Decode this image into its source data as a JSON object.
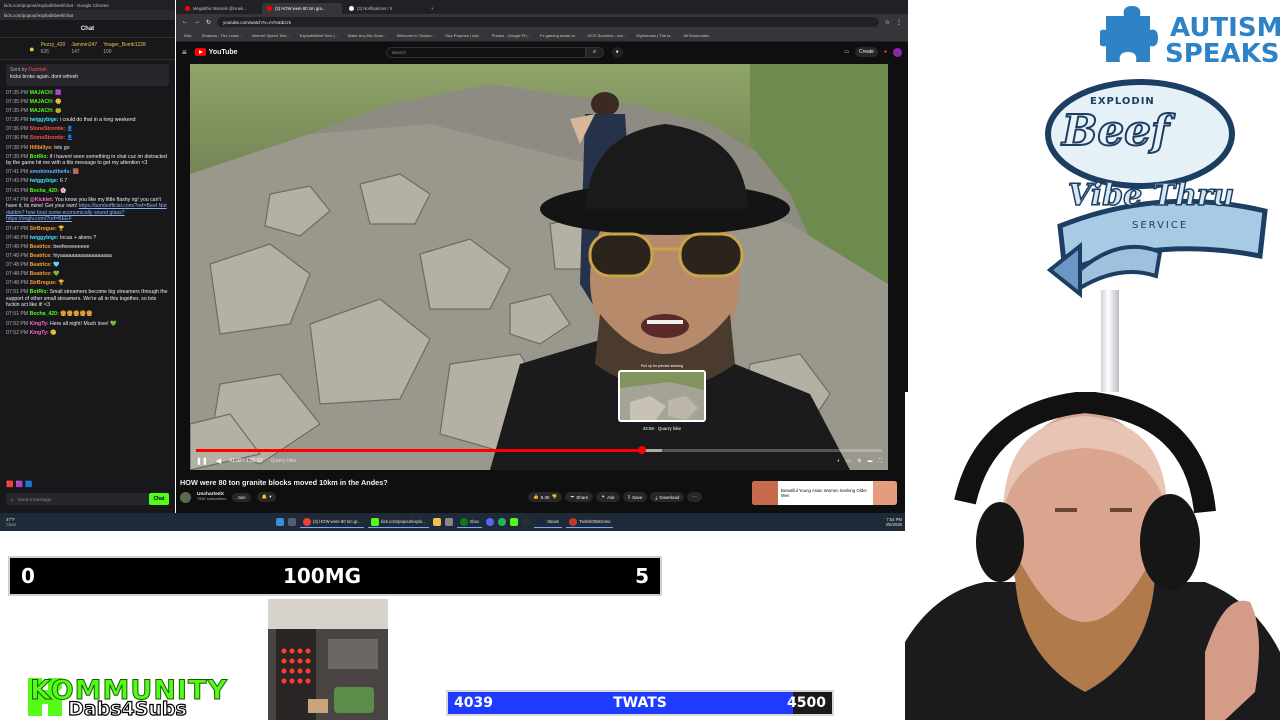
{
  "chat": {
    "window_title": "kick.com/popout/explodinbeef/chat - Google Chrome",
    "url": "kick.com/popout/explodinbeef/chat",
    "header": "Chat",
    "gifters": [
      {
        "name": "Pezzy_420",
        "count": "626"
      },
      {
        "name": "Jammin247",
        "count": "147"
      },
      {
        "name": "Yeager_Bomb1228",
        "count": "100"
      }
    ],
    "pinned_by": "Sent by",
    "pinned_user": "Dachiah",
    "pinned_text": "kicks broke again. dont refresh",
    "messages": [
      {
        "time": "07:35 PM",
        "user": "MAJACH:",
        "color": "u-green",
        "text": "🟪"
      },
      {
        "time": "07:35 PM",
        "user": "MAJACH:",
        "color": "u-green",
        "text": "🥲"
      },
      {
        "time": "07:35 PM",
        "user": "MAJACH:",
        "color": "u-green",
        "text": "🐸"
      },
      {
        "time": "07:36 PM",
        "user": "twiggybige:",
        "color": "u-cyan",
        "text": "i could do that in a long weekend"
      },
      {
        "time": "07:36 PM",
        "user": "StoneStrontie:",
        "color": "u-red",
        "text": "👤"
      },
      {
        "time": "07:36 PM",
        "user": "StoneStrontie:",
        "color": "u-red",
        "text": "👤"
      },
      {
        "time": "07:38 PM",
        "user": "Hillbillys:",
        "color": "u-orange",
        "text": "lets go"
      },
      {
        "time": "07:39 PM",
        "user": "BotRix:",
        "color": "u-green",
        "text": "if i havent seen something in chat cuz im distracted by the game hit me with a ttts message to get my attention <3"
      },
      {
        "time": "07:41 PM",
        "user": "smokinoutthe4s:",
        "color": "u-blue",
        "text": "🟫"
      },
      {
        "time": "07:43 PM",
        "user": "twiggybige:",
        "color": "u-cyan",
        "text": "6 7"
      },
      {
        "time": "07:43 PM",
        "user": "Bocha_420:",
        "color": "u-green",
        "text": "🌸"
      },
      {
        "time": "07:47 PM",
        "user": "@Kicklet:",
        "color": "u-pink",
        "text": "You know you like my little flashy rig! you can't have it, its mine! Get your own!",
        "link": "https://bombofficial.com/?ref=Beef Not dabbin? how bout some economically sound glass? https://ooglv.com/?ref=BEEF"
      },
      {
        "time": "07:47 PM",
        "user": "StrBrogue:",
        "color": "u-orange",
        "text": "🏆"
      },
      {
        "time": "07:48 PM",
        "user": "twiggybige:",
        "color": "u-cyan",
        "text": "Incas + aliens ?"
      },
      {
        "time": "07:48 PM",
        "user": "BeatrIce:",
        "color": "u-orange",
        "text": "beefeeeeeeeee"
      },
      {
        "time": "07:48 PM",
        "user": "BeatrIce:",
        "color": "u-orange",
        "text": "hiyaaaaaaaaaaaaaaaaaa"
      },
      {
        "time": "07:48 PM",
        "user": "BeatrIce:",
        "color": "u-orange",
        "text": "🩵"
      },
      {
        "time": "07:48 PM",
        "user": "BeatrIce:",
        "color": "u-orange",
        "text": "💚"
      },
      {
        "time": "07:48 PM",
        "user": "StrBrogue:",
        "color": "u-orange",
        "text": "🏆"
      },
      {
        "time": "07:51 PM",
        "user": "BotRix:",
        "color": "u-green",
        "text": "Small streamers become big streamers through the support of other small streamers. We're all in this together, so lets fuckin act like it! <3"
      },
      {
        "time": "07:51 PM",
        "user": "Bocha_420:",
        "color": "u-green",
        "text": "🍔🍔🍔🍔🍔"
      },
      {
        "time": "07:52 PM",
        "user": "KingTy:",
        "color": "u-pink",
        "text": "Here all night! Much love! 💚"
      },
      {
        "time": "07:52 PM",
        "user": "KingTy:",
        "color": "u-pink",
        "text": "🥲"
      }
    ],
    "input_placeholder": "Send a message",
    "send_label": "Chat"
  },
  "browser": {
    "tabs": [
      {
        "label": "Megalithic Marvels @Ixnek...",
        "color": "#ff0000",
        "active": false
      },
      {
        "label": "(3) HOW were 80 ton gra...",
        "color": "#ff0000",
        "active": true
      },
      {
        "label": "(3) Notifications / X",
        "color": "#ffffff",
        "active": false
      }
    ],
    "url": "youtube.com/watch?v=m7eatbzzk",
    "bookmarks": [
      "Kick",
      "Shakeus - The Leadi...",
      "Internet Speed Test...",
      "ExplodinBeef Scrs |...",
      "Make Any Mic Soun...",
      "Welcome to Okloho...",
      "Your Purpose | clot...",
      "Photos - Google Ph...",
      "Fe gaming music w...",
      "KICK Bounties - win...",
      "Mymonaris | The la...",
      "All Bookmarks"
    ]
  },
  "youtube": {
    "brand": "YouTube",
    "search_placeholder": "Search",
    "create_label": "Create",
    "video_title": "HOW were 80 ton granite blocks moved 10km in the Andes?",
    "channel": "UnchartedX",
    "subscribers": "783K subscribers",
    "join_label": "Join",
    "time_current": "41:32",
    "time_total": "1:26:33",
    "chapter": "Quarry hike",
    "progress_fraction": 0.65,
    "buffer_fraction": 0.68,
    "hover_time": "43:59",
    "hover_chapter": "Quarry hike",
    "hover_tip": "Pull up for precise seeking",
    "likes": "8.3K",
    "share_label": "Share",
    "ask_label": "Ask",
    "save_label": "Save",
    "download_label": "Download",
    "ad_text": "Beautiful Young Asian Women Seeking Older Men"
  },
  "taskbar": {
    "weather_temp": "47°F",
    "weather_desc": "Clear",
    "apps": [
      "(3) HOW were 80 ton gr...",
      "kick.com/popout/explo...",
      "Xbox",
      "Steam",
      "TwitchOBsDemo"
    ],
    "time": "7:54 PM",
    "date": "2/5/2026"
  },
  "overlays": {
    "score_top": {
      "left": "0",
      "center": "100MG",
      "right": "5"
    },
    "score_bottom": {
      "left": "4039",
      "center": "TWATS",
      "right": "4500",
      "fill_fraction": 0.8976
    },
    "kommunity_title": "KOMMUNITY",
    "kommunity_sub": "Dabs4Subs",
    "autism_line1": "AUTISM",
    "autism_line2": "SPEAKS",
    "beef_top": "EXPLODIN",
    "beef_main": "Beef",
    "beef_script": "Vibe Thru",
    "beef_service": "SERVICE"
  },
  "colors": {
    "kick_green": "#53fc18",
    "youtube_red": "#ff0000",
    "score_blue": "#1f3bff",
    "autism_blue": "#2e83c6"
  }
}
